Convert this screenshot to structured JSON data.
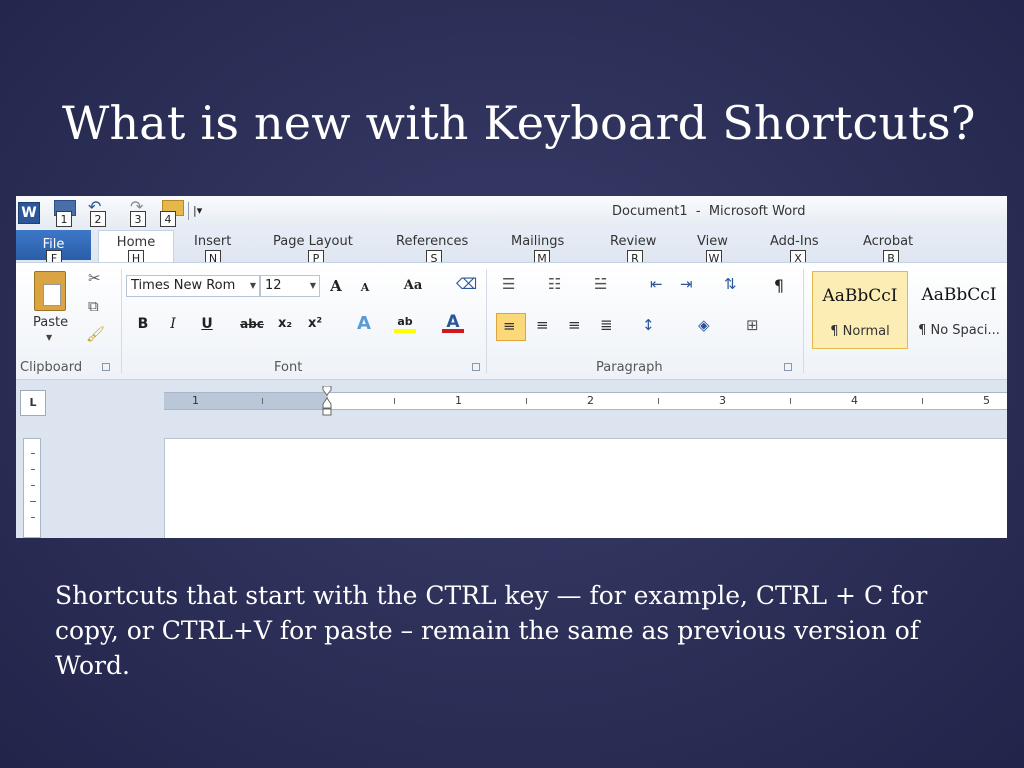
{
  "slide": {
    "title": "What is new with Keyboard Shortcuts?",
    "body": "Shortcuts that start with the CTRL key — for example, CTRL + C for copy, or CTRL+V for paste –  remain the same as previous version of Word."
  },
  "word": {
    "logo": "W",
    "window_title": "Document1  -  Microsoft Word",
    "qat_more": "|▾",
    "qat_keytips": [
      "1",
      "2",
      "3",
      "4"
    ],
    "tabs": [
      {
        "label": "File",
        "keytip": "F"
      },
      {
        "label": "Home",
        "keytip": "H"
      },
      {
        "label": "Insert",
        "keytip": "N"
      },
      {
        "label": "Page Layout",
        "keytip": "P"
      },
      {
        "label": "References",
        "keytip": "S"
      },
      {
        "label": "Mailings",
        "keytip": "M"
      },
      {
        "label": "Review",
        "keytip": "R"
      },
      {
        "label": "View",
        "keytip": "W"
      },
      {
        "label": "Add-Ins",
        "keytip": "X"
      },
      {
        "label": "Acrobat",
        "keytip": "B"
      }
    ],
    "clipboard": {
      "paste_label": "Paste",
      "group_label": "Clipboard"
    },
    "font": {
      "name": "Times New Rom",
      "size": "12",
      "grow": "A",
      "shrink": "A",
      "change_case": "Aa",
      "bold": "B",
      "italic": "I",
      "underline": "U",
      "strikethrough": "abc",
      "subscript": "x₂",
      "superscript": "x²",
      "text_effects": "A",
      "highlight": "ab",
      "font_color": "A",
      "group_label": "Font"
    },
    "paragraph": {
      "show_marks": "¶",
      "group_label": "Paragraph"
    },
    "styles": [
      {
        "sample": "AaBbCcI",
        "name": "¶ Normal"
      },
      {
        "sample": "AaBbCcI",
        "name": "¶ No Spaci..."
      }
    ],
    "ruler": {
      "tab_selector": "L",
      "labels": [
        "1",
        "1",
        "2",
        "3",
        "4",
        "5"
      ]
    },
    "colors": {
      "file_tab": "#2a5ea8",
      "highlight": "#ffff00",
      "font_color": "#d0191f",
      "selected": "#fbd97a"
    }
  }
}
